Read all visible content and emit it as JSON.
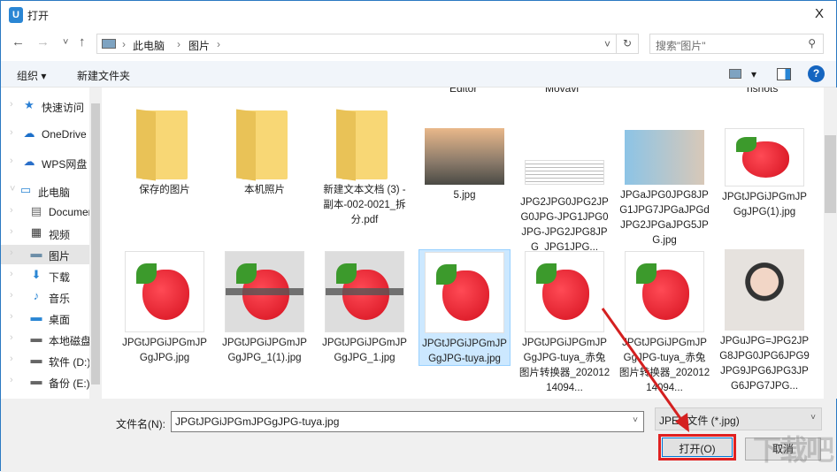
{
  "window": {
    "title": "打开",
    "close": "X",
    "app_icon": "U"
  },
  "nav": {
    "back": "←",
    "forward": "→",
    "recent": "˅",
    "up": "↑",
    "breadcrumb": [
      "此电脑",
      "图片"
    ],
    "sep": "›",
    "dropdown": "˅",
    "refresh": "↻",
    "search_placeholder": "搜索\"图片\"",
    "search_icon": "⚲"
  },
  "toolbar": {
    "organize": "组织 ▾",
    "new_folder": "新建文件夹",
    "view": "▾",
    "help": "?"
  },
  "sidebar": {
    "items": [
      {
        "label": "快速访问",
        "icon": "star-icon",
        "glyph": "★",
        "color": "#2a7fd4"
      },
      {
        "label": "OneDrive",
        "icon": "cloud-icon",
        "glyph": "☁",
        "color": "#1c6fc9"
      },
      {
        "label": "WPS网盘",
        "icon": "cloud-icon",
        "glyph": "☁",
        "color": "#2a6fc9"
      },
      {
        "label": "此电脑",
        "icon": "computer-icon",
        "glyph": "▭",
        "color": "#2a86d4"
      },
      {
        "label": "Documents",
        "icon": "document-icon",
        "glyph": "▤",
        "color": "#666"
      },
      {
        "label": "视频",
        "icon": "video-icon",
        "glyph": "▦",
        "color": "#333"
      },
      {
        "label": "图片",
        "icon": "pictures-icon",
        "glyph": "▬",
        "color": "#6c8ea8"
      },
      {
        "label": "下载",
        "icon": "download-icon",
        "glyph": "⬇",
        "color": "#2a86d4"
      },
      {
        "label": "音乐",
        "icon": "music-icon",
        "glyph": "♪",
        "color": "#2a86d4"
      },
      {
        "label": "桌面",
        "icon": "desktop-icon",
        "glyph": "▬",
        "color": "#2a86d4"
      },
      {
        "label": "本地磁盘",
        "icon": "drive-icon",
        "glyph": "▬",
        "color": "#666"
      },
      {
        "label": "软件 (D:)",
        "icon": "drive-icon",
        "glyph": "▬",
        "color": "#666"
      },
      {
        "label": "备份 (E:)",
        "icon": "drive-icon",
        "glyph": "▬",
        "color": "#666"
      }
    ]
  },
  "partial_labels": [
    "Editor",
    "Movavi",
    "nshots"
  ],
  "files": [
    {
      "name": "保存的图片",
      "type": "folder"
    },
    {
      "name": "本机照片",
      "type": "folder"
    },
    {
      "name": "新建文本文档 (3) - 副本-002-0021_拆分.pdf",
      "type": "folder"
    },
    {
      "name": "5.jpg",
      "type": "photo"
    },
    {
      "name": "JPG2JPG0JPG2JPG0JPG-JPG1JPG0JPG-JPG2JPG8JPG_JPG1JPG...",
      "type": "doc"
    },
    {
      "name": "JPGaJPG0JPG8JPG1JPG7JPGaJPGdJPG2JPGaJPG5JPG.jpg",
      "type": "boy"
    },
    {
      "name": "JPGtJPGiJPGmJPGgJPG(1).jpg",
      "type": "straw"
    },
    {
      "name": "JPGtJPGiJPGmJPGgJPG.jpg",
      "type": "straw"
    },
    {
      "name": "JPGtJPGiJPGmJPGgJPG_1(1).jpg",
      "type": "grey"
    },
    {
      "name": "JPGtJPGiJPGmJPGgJPG_1.jpg",
      "type": "grey"
    },
    {
      "name": "JPGtJPGiJPGmJPGgJPG-tuya.jpg",
      "type": "straw",
      "selected": true
    },
    {
      "name": "JPGtJPGiJPGmJPGgJPG-tuya_赤兔图片转换器_20201214094...",
      "type": "straw"
    },
    {
      "name": "JPGtJPGiJPGmJPGgJPG-tuya_赤兔图片转换器_20201214094...",
      "type": "straw"
    },
    {
      "name": "JPGuJPG=JPG2JPG8JPG0JPG6JPG9JPG9JPG6JPG3JPG6JPG7JPG...",
      "type": "girl"
    }
  ],
  "bottom": {
    "filename_label": "文件名(N):",
    "filename_value": "JPGtJPGiJPGmJPGgJPG-tuya.jpg",
    "filetype": "JPEG文件 (*.jpg)",
    "open": "打开(O)",
    "cancel": "取消",
    "dropdown": "˅"
  },
  "watermark": "下载吧"
}
